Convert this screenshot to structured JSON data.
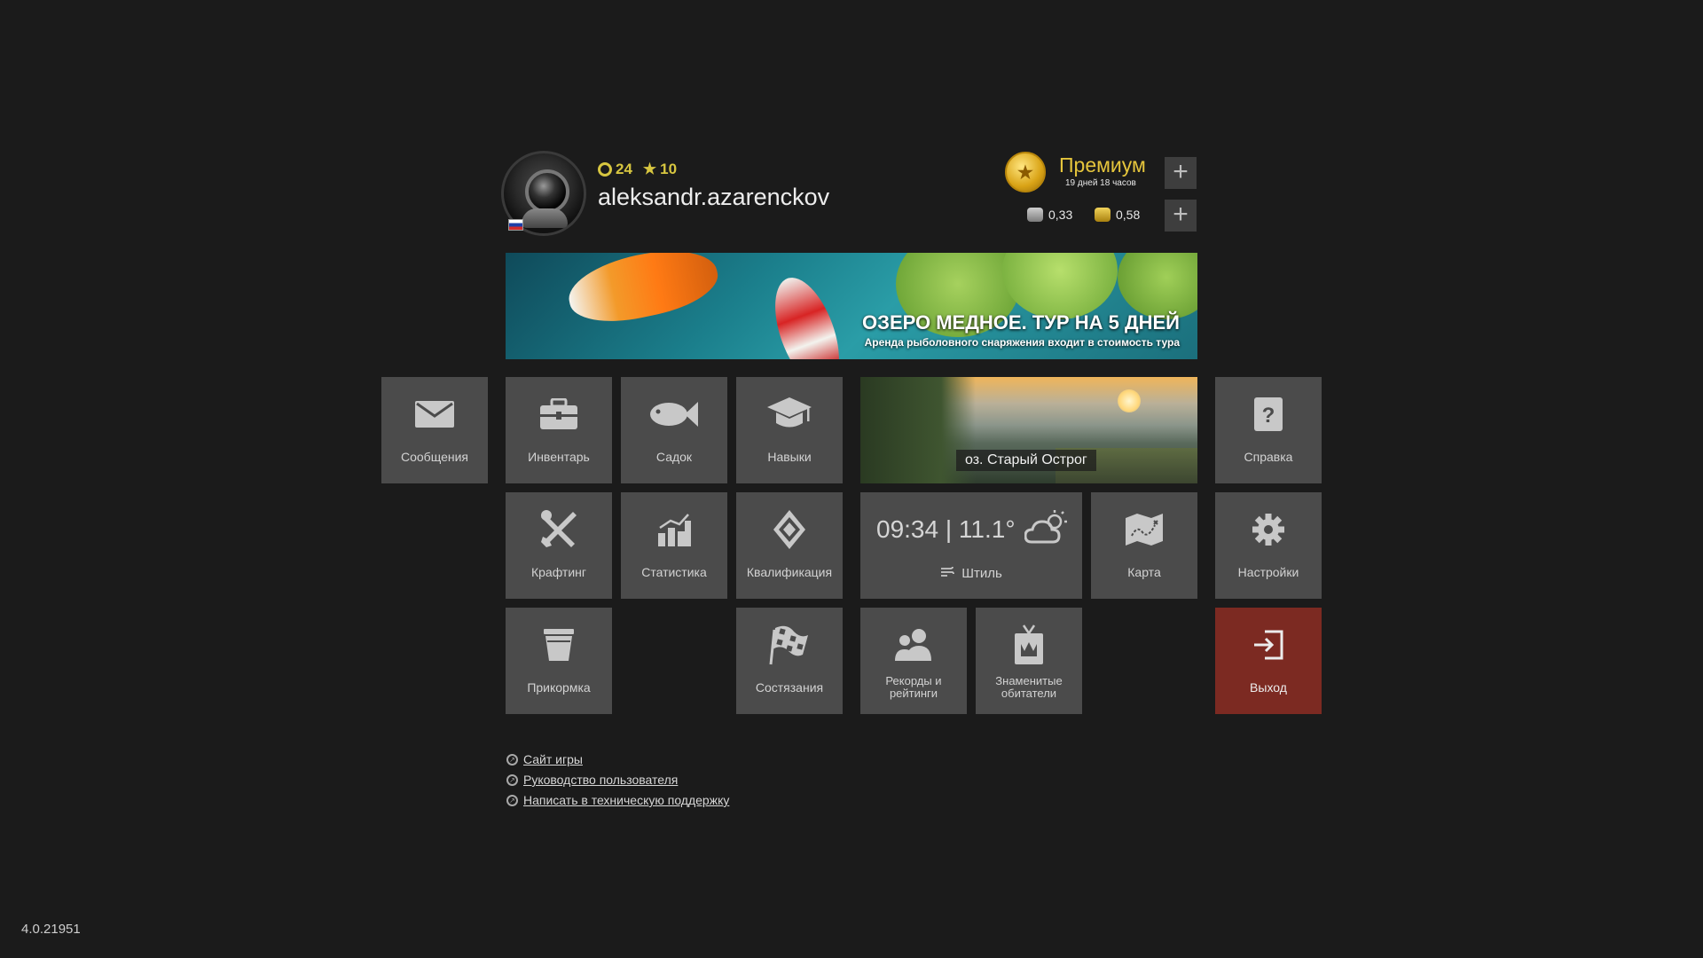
{
  "profile": {
    "level": "24",
    "stars": "10",
    "username": "aleksandr.azarenckov",
    "flag": "ru-flag"
  },
  "premium": {
    "title": "Премиум",
    "remaining": "19 дней 18 часов",
    "plus_label": "+"
  },
  "currency": {
    "silver": "0,33",
    "gold": "0,58",
    "plus_label": "+"
  },
  "banner": {
    "title": "ОЗЕРО МЕДНОЕ. ТУР НА 5 ДНЕЙ",
    "subtitle": "Аренда рыболовного снаряжения входит в стоимость тура"
  },
  "tiles": {
    "messages": "Сообщения",
    "inventory": "Инвентарь",
    "keepnet": "Садок",
    "skills": "Навыки",
    "help": "Справка",
    "crafting": "Крафтинг",
    "statistics": "Статистика",
    "qualification": "Квалификация",
    "map": "Карта",
    "settings": "Настройки",
    "groundbait": "Прикормка",
    "competitions": "Состязания",
    "records_line1": "Рекорды и",
    "records_line2": "рейтинги",
    "trophies_line1": "Знаменитые",
    "trophies_line2": "обитатели",
    "exit": "Выход"
  },
  "location": {
    "name": "оз. Старый Острог"
  },
  "weather": {
    "time": "09:34",
    "separator": "|",
    "temperature": "11.1°",
    "wind": "Штиль"
  },
  "links": [
    "Сайт игры",
    "Руководство пользователя",
    "Написать в техническую поддержку"
  ],
  "version": "4.0.21951",
  "colors": {
    "background": "#1b1b1b",
    "tile": "#4b4b4b",
    "exit_tile": "#7c2a22",
    "premium_gold": "#e5c53c"
  }
}
